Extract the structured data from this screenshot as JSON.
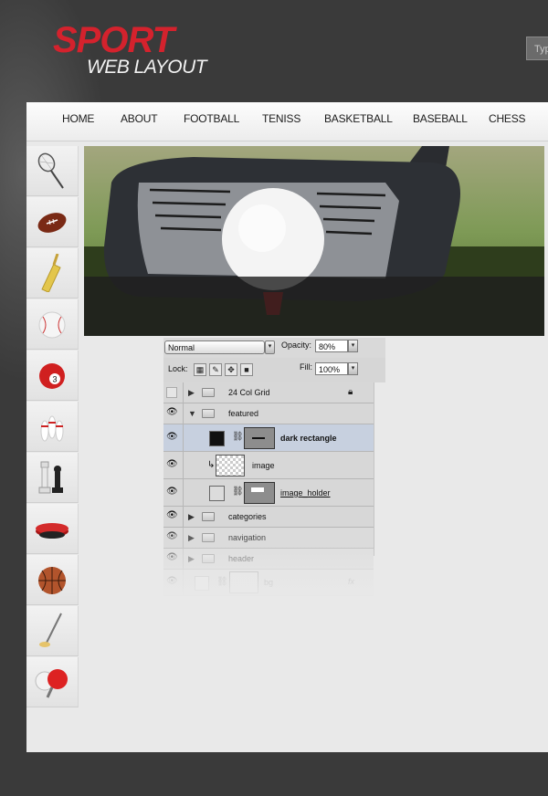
{
  "logo": {
    "sport": "SPORT",
    "web_layout": "WEB LAYOUT"
  },
  "search": {
    "placeholder": "Typ"
  },
  "nav": [
    "HOME",
    "ABOUT",
    "FOOTBALL",
    "TENISS",
    "BASKETBALL",
    "BASEBALL",
    "CHESS"
  ],
  "categories": [
    "badminton-racket-icon",
    "football-icon",
    "cricket-bat-icon",
    "baseball-icon",
    "billiard-ball-icon",
    "bowling-pins-icon",
    "chess-pieces-icon",
    "hockey-puck-icon",
    "basketball-icon",
    "golf-club-icon",
    "ping-pong-icon"
  ],
  "featured": {
    "image": "golf-driver-and-ball-photo",
    "dark_rectangle_opacity": 0.8
  },
  "layers_panel": {
    "blend_mode": "Normal",
    "opacity_label": "Opacity:",
    "opacity_value": "80%",
    "lock_label": "Lock:",
    "fill_label": "Fill:",
    "fill_value": "100%",
    "layers": [
      {
        "name": "24 Col Grid",
        "type": "group",
        "visible": false,
        "collapsed": true,
        "locked": true
      },
      {
        "name": "featured",
        "type": "group",
        "visible": true,
        "collapsed": false
      },
      {
        "name": "dark rectangle",
        "type": "shape",
        "visible": true,
        "selected": true
      },
      {
        "name": "image",
        "type": "image",
        "visible": true,
        "clipped": true
      },
      {
        "name": "image_holder",
        "type": "shape",
        "visible": true
      },
      {
        "name": "categories",
        "type": "group",
        "visible": true,
        "collapsed": true
      },
      {
        "name": "navigation",
        "type": "group",
        "visible": true,
        "collapsed": true
      },
      {
        "name": "header",
        "type": "group",
        "visible": true,
        "collapsed": true
      },
      {
        "name": "bg",
        "type": "layer",
        "visible": true,
        "fx": "fx"
      }
    ]
  },
  "colors": {
    "brand_red": "#d4222d",
    "page_bg": "#3a3a3a",
    "panel_bg": "#e9e9e9",
    "selected_layer": "#c7d0df"
  }
}
